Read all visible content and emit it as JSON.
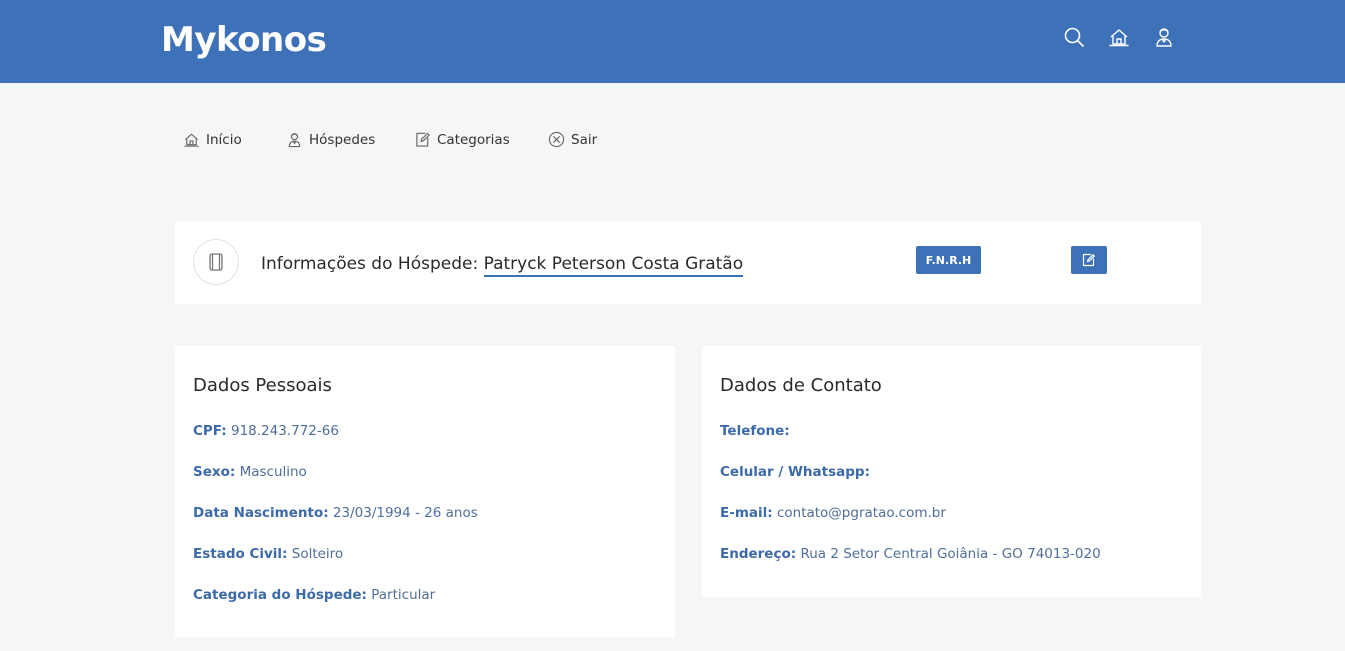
{
  "header": {
    "brand": "Mykonos",
    "icons": [
      "search-icon",
      "home-icon",
      "guest-icon"
    ],
    "color": "#3d72b9"
  },
  "nav": {
    "items": [
      {
        "label": "Início",
        "icon": "home-icon"
      },
      {
        "label": "Hóspedes",
        "icon": "guest-icon"
      },
      {
        "label": "Categorias",
        "icon": "edit-icon"
      },
      {
        "label": "Sair",
        "icon": "close-circle-icon"
      }
    ]
  },
  "guest": {
    "title_prefix": "Informações do Hóspede: ",
    "name": "Patryck Peterson Costa Gratão",
    "fnrh_label": "F.N.R.H"
  },
  "personal": {
    "title": "Dados Pessoais",
    "fields": [
      {
        "label": "CPF:",
        "value": "918.243.772-66"
      },
      {
        "label": "Sexo:",
        "value": "Masculino"
      },
      {
        "label": "Data Nascimento:",
        "value": "23/03/1994 - 26 anos"
      },
      {
        "label": "Estado Civil:",
        "value": "Solteiro"
      },
      {
        "label": "Categoria do Hóspede:",
        "value": "Particular"
      }
    ]
  },
  "contact": {
    "title": "Dados de Contato",
    "fields": [
      {
        "label": "Telefone:",
        "value": ""
      },
      {
        "label": "Celular / Whatsapp:",
        "value": ""
      },
      {
        "label": "E-mail:",
        "value": "contato@pgratao.com.br"
      },
      {
        "label": "Endereço:",
        "value": "Rua 2 Setor Central Goiânia - GO 74013-020"
      }
    ]
  }
}
